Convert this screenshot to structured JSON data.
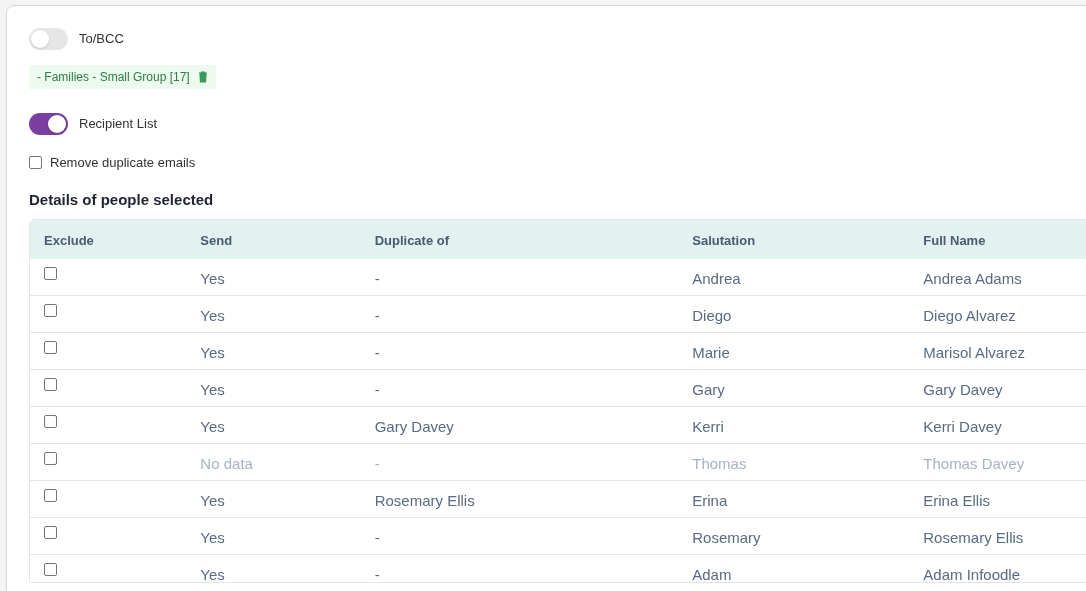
{
  "to_bcc": {
    "label": "To/BCC",
    "on": false
  },
  "group_tag": {
    "label": "- Families - Small Group [17]"
  },
  "recipient_list": {
    "label": "Recipient List",
    "on": true
  },
  "remove_duplicates": {
    "label": "Remove duplicate emails",
    "checked": false
  },
  "section_title": "Details of people selected",
  "table": {
    "columns": [
      "Exclude",
      "Send",
      "Duplicate of",
      "Salutation",
      "Full Name"
    ],
    "rows": [
      {
        "excluded": false,
        "disabled": false,
        "send": "Yes",
        "duplicate_of": "-",
        "salutation": "Andrea",
        "full_name": "Andrea Adams"
      },
      {
        "excluded": false,
        "disabled": false,
        "send": "Yes",
        "duplicate_of": "-",
        "salutation": "Diego",
        "full_name": "Diego Alvarez"
      },
      {
        "excluded": false,
        "disabled": false,
        "send": "Yes",
        "duplicate_of": "-",
        "salutation": "Marie",
        "full_name": "Marisol Alvarez"
      },
      {
        "excluded": false,
        "disabled": false,
        "send": "Yes",
        "duplicate_of": "-",
        "salutation": "Gary",
        "full_name": "Gary Davey"
      },
      {
        "excluded": false,
        "disabled": false,
        "send": "Yes",
        "duplicate_of": "Gary Davey",
        "salutation": "Kerri",
        "full_name": "Kerri Davey"
      },
      {
        "excluded": false,
        "disabled": true,
        "send": "No data",
        "duplicate_of": "-",
        "salutation": "Thomas",
        "full_name": "Thomas Davey"
      },
      {
        "excluded": false,
        "disabled": false,
        "send": "Yes",
        "duplicate_of": "Rosemary Ellis",
        "salutation": "Erina",
        "full_name": "Erina Ellis"
      },
      {
        "excluded": false,
        "disabled": false,
        "send": "Yes",
        "duplicate_of": "-",
        "salutation": "Rosemary",
        "full_name": "Rosemary Ellis"
      },
      {
        "excluded": false,
        "disabled": false,
        "send": "Yes",
        "duplicate_of": "-",
        "salutation": "Adam",
        "full_name": "Adam Infoodle"
      }
    ]
  }
}
